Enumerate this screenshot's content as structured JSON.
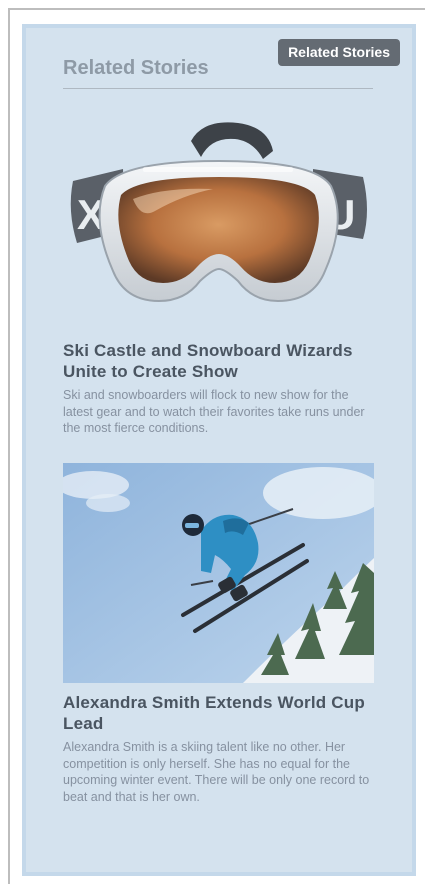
{
  "widget": {
    "tab_label": "Related Stories",
    "heading": "Related Stories"
  },
  "stories": [
    {
      "title": "Ski Castle and Snowboard Wizards Unite to Create Show",
      "description": "Ski and snowboarders will flock to new show for the latest gear and to watch their favorites take runs under the most fierce conditions.",
      "image_icon": "ski-goggles"
    },
    {
      "title": "Alexandra Smith Extends World Cup Lead",
      "description": "Alexandra Smith is a skiing talent like no other. Her competition is only herself. She has no equal for the upcoming winter event. There will be only one record to beat and that is her own.",
      "image_icon": "skier-jump"
    }
  ],
  "colors": {
    "panel_background": "#d4e2ee",
    "panel_border": "#c4d8ea",
    "tab_background": "#646b73",
    "heading": "#8e9aa6",
    "title": "#4a5561",
    "description": "#8691a0"
  }
}
